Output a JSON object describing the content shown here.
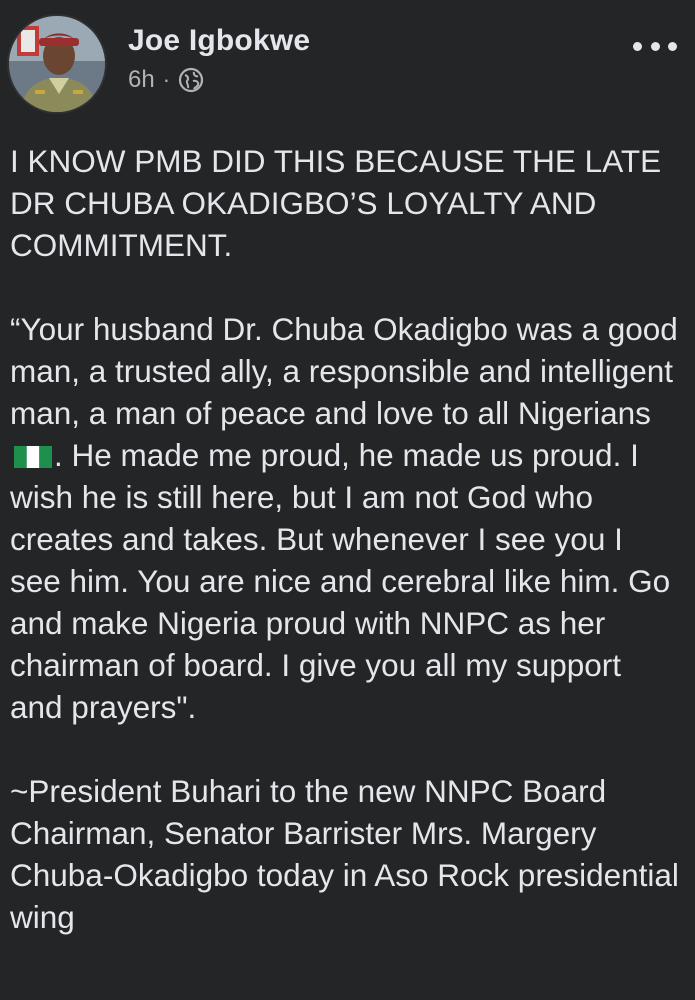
{
  "post": {
    "author_name": "Joe Igbokwe",
    "timestamp": "6h",
    "separator": "·",
    "privacy_icon": "globe-icon",
    "more_icon": "more-horizontal-icon",
    "paragraph_1": "I KNOW PMB DID THIS BECAUSE THE LATE DR CHUBA OKADIGBO’S LOYALTY AND COMMITMENT.",
    "paragraph_2_part_1": "“Your husband Dr. Chuba Okadigbo was a good man, a trusted ally, a responsible and intelligent man, a man of peace and love to all Nigerians",
    "flag_icon": "nigeria-flag-icon",
    "paragraph_2_part_2": ". He made me proud, he made us proud. I wish he is still here, but I am not God who creates and takes. But whenever I see you I see him. You are nice and cerebral like him. Go and make Nigeria proud with NNPC as her chairman of board. I give you all my support and prayers\".",
    "paragraph_3": "~President Buhari to the new NNPC Board Chairman, Senator Barrister Mrs. Margery Chuba-Okadigbo today in Aso Rock presidential wing"
  },
  "colors": {
    "background": "#242526",
    "text": "#e4e6eb",
    "secondary_text": "#b0b3b8",
    "flag_green": "#1f8f4e",
    "flag_white": "#ffffff"
  }
}
